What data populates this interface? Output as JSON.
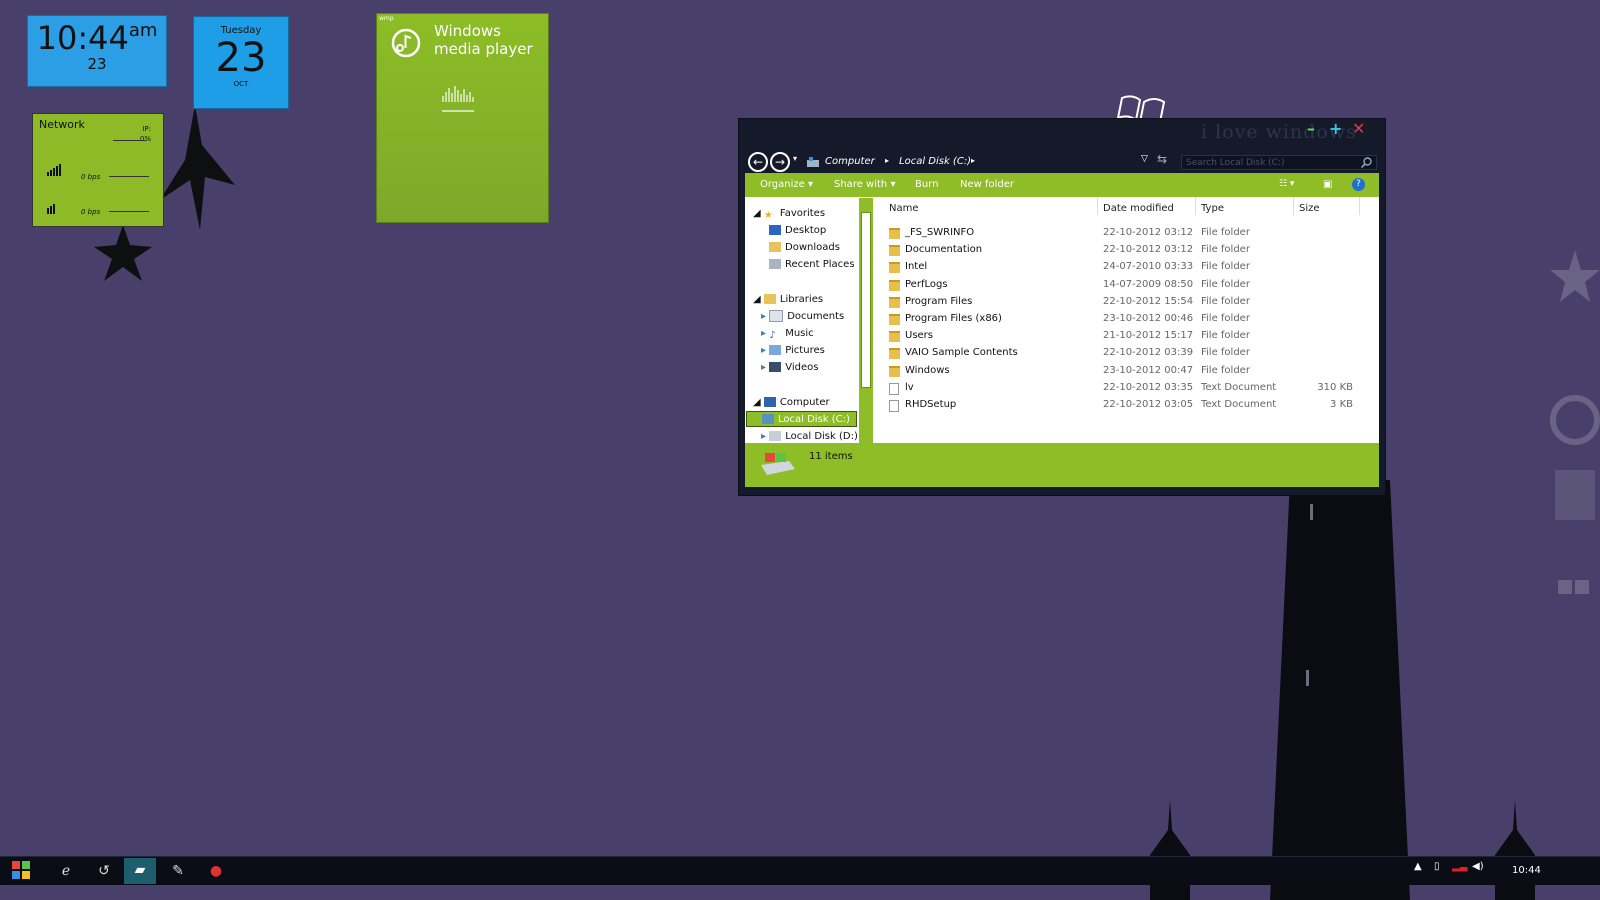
{
  "clock_gadget": {
    "time": "10:44",
    "ampm": "am",
    "day": "23"
  },
  "calendar_gadget": {
    "weekday": "Tuesday",
    "day": "23",
    "month": "OCT"
  },
  "network_gadget": {
    "title": "Network",
    "ip_label": "IP:",
    "ip_value": "0%",
    "up_rate": "0 bps",
    "down_rate": "0 bps"
  },
  "wmp_gadget": {
    "label": "wmp",
    "title_line1": "Windows",
    "title_line2": "media player"
  },
  "explorer": {
    "title_art": "i love windows",
    "address": {
      "crumb1": "Computer",
      "crumb2": "Local Disk (C:)"
    },
    "search_placeholder": "Search Local Disk (C:)",
    "toolbar": {
      "organize": "Organize",
      "share_with": "Share with",
      "burn": "Burn",
      "new_folder": "New folder"
    },
    "nav": {
      "favorites": "Favorites",
      "fav_items": [
        "Desktop",
        "Downloads",
        "Recent Places"
      ],
      "libraries": "Libraries",
      "lib_items": [
        "Documents",
        "Music",
        "Pictures",
        "Videos"
      ],
      "computer": "Computer",
      "comp_items": [
        "Local Disk (C:)",
        "Local Disk (D:)"
      ]
    },
    "columns": {
      "name": "Name",
      "date": "Date modified",
      "type": "Type",
      "size": "Size"
    },
    "rows": [
      {
        "name": "_FS_SWRINFO",
        "date": "22-10-2012 03:12",
        "type": "File folder",
        "size": "",
        "kind": "folder"
      },
      {
        "name": "Documentation",
        "date": "22-10-2012 03:12",
        "type": "File folder",
        "size": "",
        "kind": "folder"
      },
      {
        "name": "Intel",
        "date": "24-07-2010 03:33",
        "type": "File folder",
        "size": "",
        "kind": "folder"
      },
      {
        "name": "PerfLogs",
        "date": "14-07-2009 08:50",
        "type": "File folder",
        "size": "",
        "kind": "folder"
      },
      {
        "name": "Program Files",
        "date": "22-10-2012 15:54",
        "type": "File folder",
        "size": "",
        "kind": "folder"
      },
      {
        "name": "Program Files (x86)",
        "date": "23-10-2012 00:46",
        "type": "File folder",
        "size": "",
        "kind": "folder"
      },
      {
        "name": "Users",
        "date": "21-10-2012 15:17",
        "type": "File folder",
        "size": "",
        "kind": "folder"
      },
      {
        "name": "VAIO Sample Contents",
        "date": "22-10-2012 03:39",
        "type": "File folder",
        "size": "",
        "kind": "folder"
      },
      {
        "name": "Windows",
        "date": "23-10-2012 00:47",
        "type": "File folder",
        "size": "",
        "kind": "folder"
      },
      {
        "name": "lv",
        "date": "22-10-2012 03:35",
        "type": "Text Document",
        "size": "310 KB",
        "kind": "file"
      },
      {
        "name": "RHDSetup",
        "date": "22-10-2012 03:05",
        "type": "Text Document",
        "size": "3 KB",
        "kind": "file"
      }
    ],
    "status_count": "11 items"
  },
  "taskbar": {
    "clock": "10:44"
  },
  "colors": {
    "accent_green": "#8ebd27",
    "gadget_blue": "#2b9ee6",
    "desktop": "#48406a"
  }
}
